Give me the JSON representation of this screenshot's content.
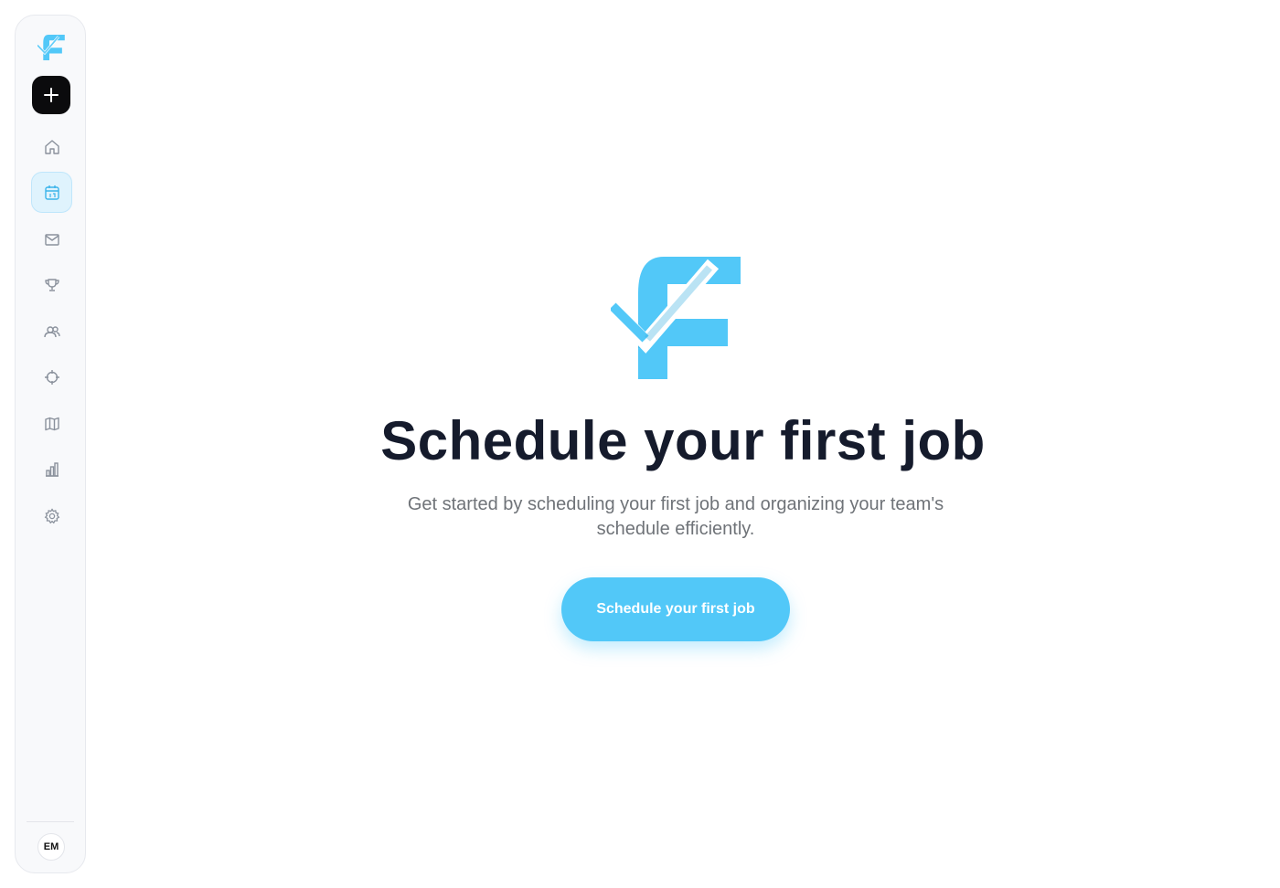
{
  "colors": {
    "brand": "#52c8f8",
    "title": "#151b2c",
    "subtitle": "#6f7378",
    "active_nav_bg": "#dff3fd"
  },
  "sidebar": {
    "logo": "brand-logo-icon",
    "new_button_icon": "plus-icon",
    "items": [
      {
        "icon": "home-icon",
        "active": false
      },
      {
        "icon": "calendar-icon",
        "active": true
      },
      {
        "icon": "mail-icon",
        "active": false
      },
      {
        "icon": "trophy-icon",
        "active": false
      },
      {
        "icon": "users-icon",
        "active": false
      },
      {
        "icon": "crosshair-icon",
        "active": false
      },
      {
        "icon": "map-icon",
        "active": false
      },
      {
        "icon": "bar-chart-icon",
        "active": false
      },
      {
        "icon": "gear-icon",
        "active": false
      }
    ],
    "avatar_initials": "EM"
  },
  "main": {
    "title": "Schedule your first job",
    "subtitle": "Get started by scheduling your first job and organizing your team's schedule efficiently.",
    "cta_label": "Schedule your first job"
  }
}
